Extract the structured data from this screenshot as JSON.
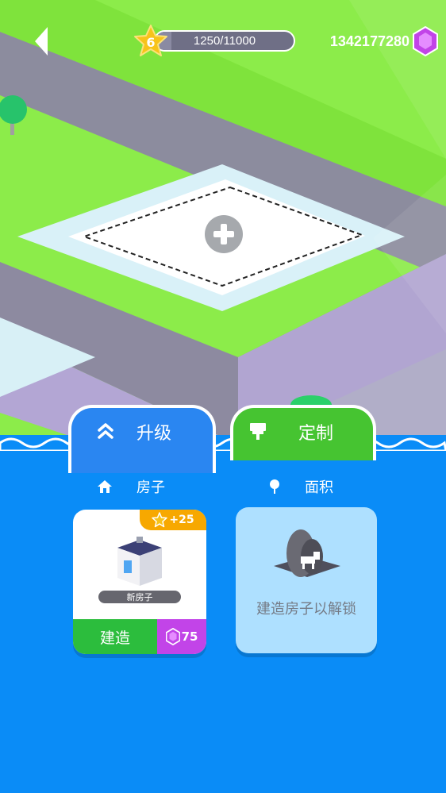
{
  "hud": {
    "level": "6",
    "xp_text": "1250/11000",
    "xp_progress": 0.1136,
    "gems_count": "1342177280"
  },
  "tabs": {
    "upgrade_label": "升级",
    "custom_label": "定制"
  },
  "sections": {
    "house_title": "房子",
    "area_title": "面积"
  },
  "house_card": {
    "xp_bonus": "+25",
    "name": "新房子",
    "build_label": "建造",
    "price": "75"
  },
  "area_card": {
    "unlock_text": "建造房子以解锁"
  },
  "colors": {
    "grass": "#8cec4a",
    "road": "#8c8c9e",
    "panel_blue": "#0a8cf7",
    "tab_green": "#46c431",
    "gem_purple": "#c244e8",
    "star_gold": "#f7c31a"
  }
}
